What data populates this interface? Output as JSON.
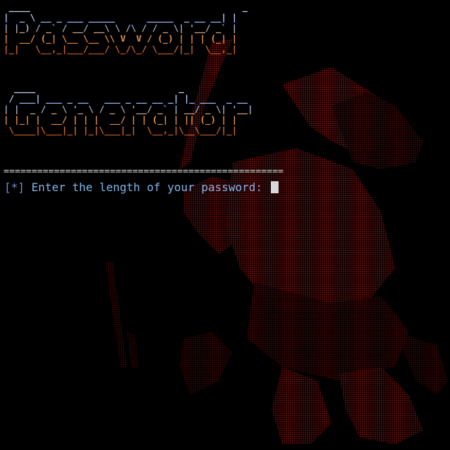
{
  "terminal": {
    "banner_line1": " ____                                        _\n|  _ \\ __ _ ___ _____      _____  _ __ __| |\n| |_) / _` / __/ __\\ \\ /\\ / / _ \\| '__/ _` |\n|  __/ (_| \\__ \\__ \\\\ V  V / (_) | | | (_| |\n|_|   \\__,_|___/___/ \\_/\\_/ \\___/|_|  \\__,_|",
    "banner_line2": "  ____                           _\n / ___| ___ _ __   ___ _ __ __ _| |_ ___  _ __\n| |  _ / _ \\ '_ \\ / _ \\ '__/ _` | __/ _ \\| '__|\n| |_| |  __/ | | |  __/ | | (_| | || (_) | |\n \\____|\\___|_| |_|\\___|_|  \\__,_|\\__\\___/|_|",
    "divider": "==================================================",
    "prompt_tag": "[*]",
    "prompt_text": " Enter the length of your password: "
  },
  "colors": {
    "background": "#000000",
    "art": "#5a0000",
    "prompt": "#7fb3e8",
    "cursor": "#d8d8d8"
  }
}
